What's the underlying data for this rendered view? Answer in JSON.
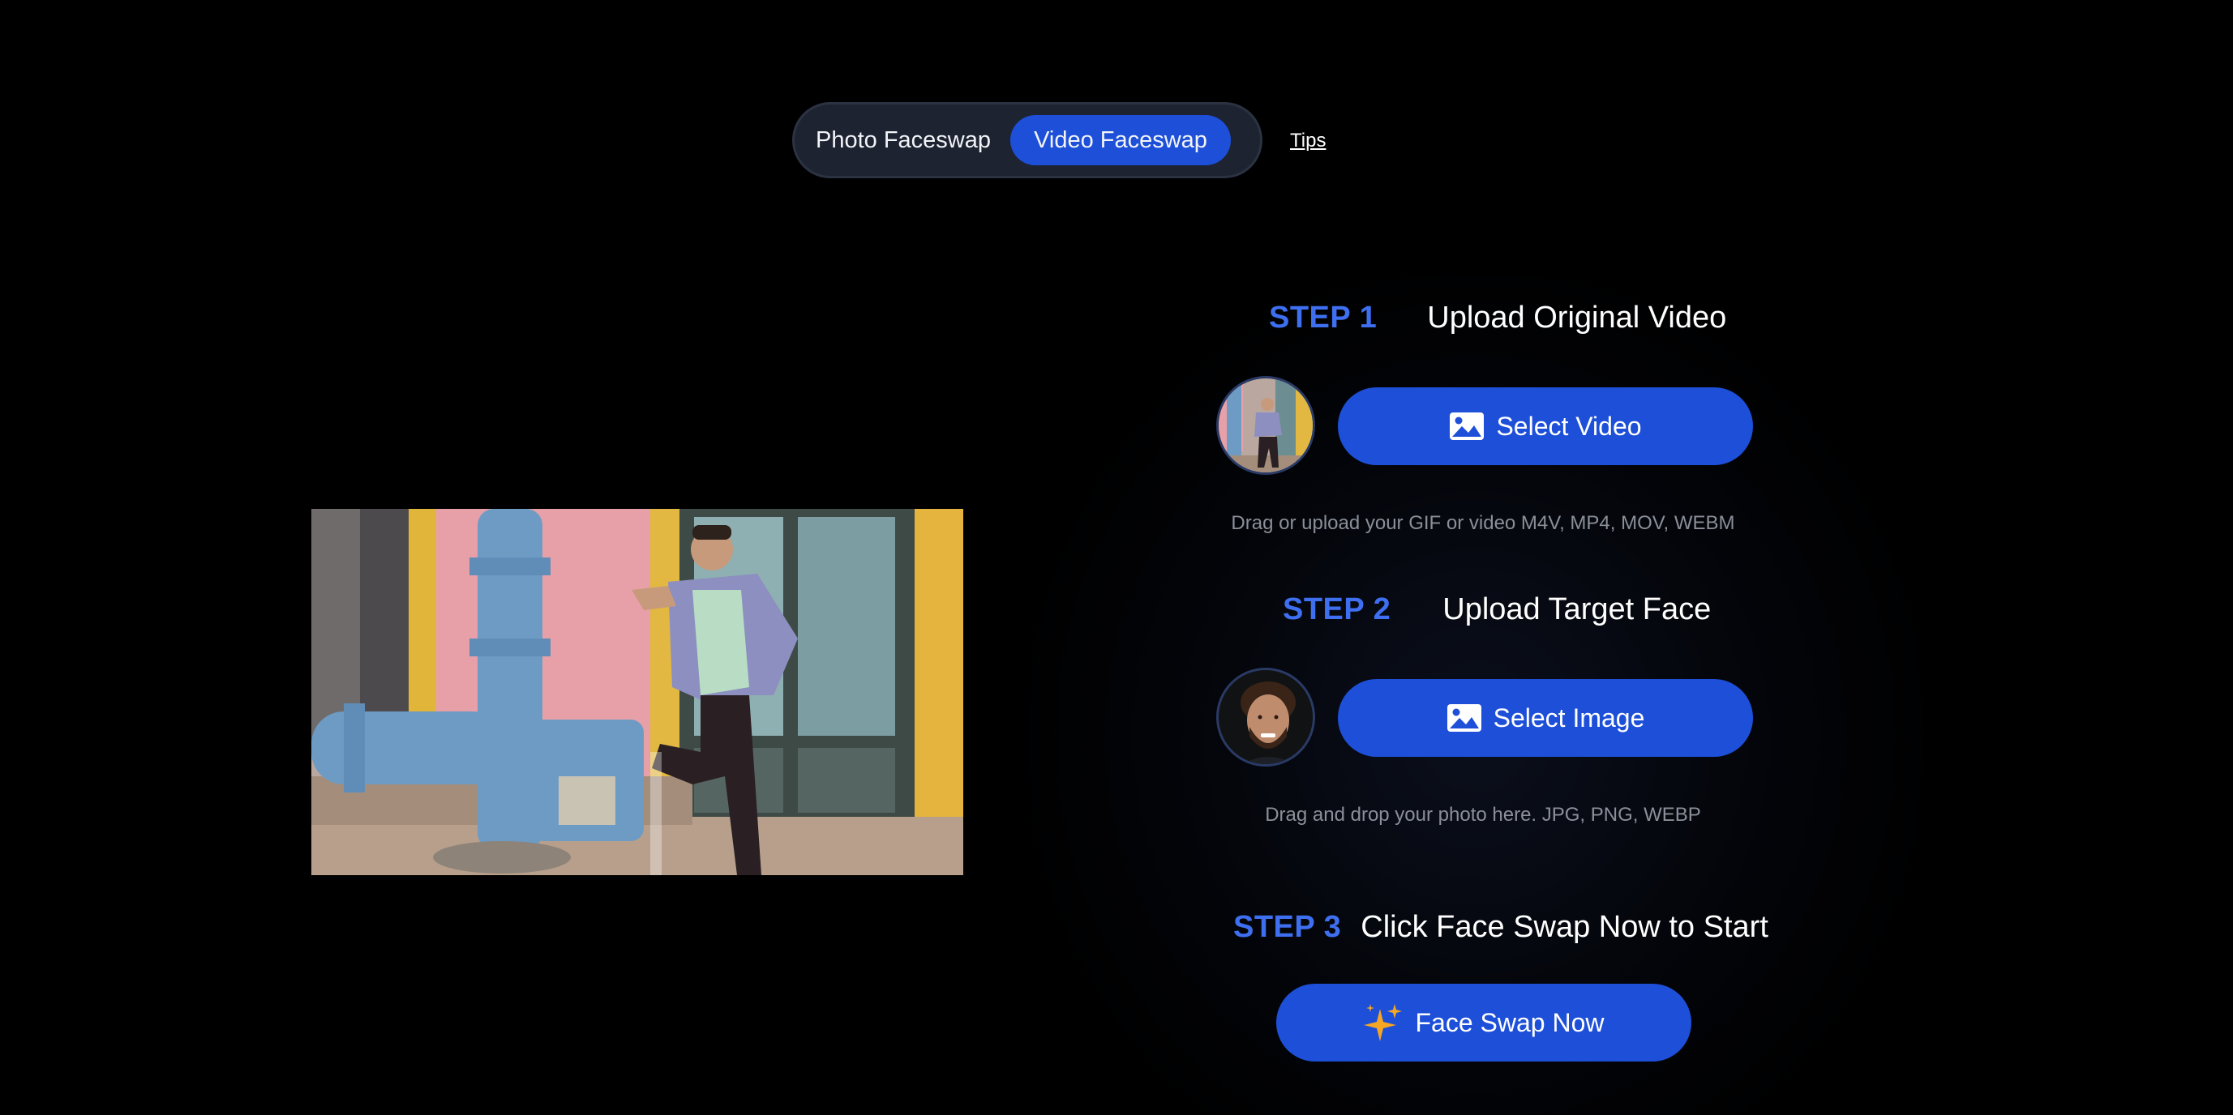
{
  "mode_toggle": {
    "photo_label": "Photo Faceswap",
    "video_label": "Video Faceswap",
    "active": "Video Faceswap"
  },
  "tips_label": "Tips",
  "steps": {
    "step1": {
      "number": "STEP 1",
      "title": "Upload Original Video",
      "button_label": "Select Video",
      "hint": "Drag or upload your GIF or video M4V, MP4, MOV, WEBM"
    },
    "step2": {
      "number": "STEP 2",
      "title": "Upload Target Face",
      "button_label": "Select Image",
      "hint": "Drag and drop your photo here. JPG, PNG, WEBP"
    },
    "step3": {
      "number": "STEP 3",
      "title": "Click Face Swap Now to Start",
      "button_label": "Face Swap Now"
    }
  },
  "icons": {
    "select_video": "image-icon",
    "select_image": "image-icon",
    "face_swap": "sparkles-icon"
  },
  "colors": {
    "background": "#000000",
    "accent": "#1d4fd8",
    "step_number": "#3e6ff0",
    "hint_text": "#8a8f99",
    "toggle_bg": "#1d2330",
    "sparkle": "#f5a623"
  }
}
